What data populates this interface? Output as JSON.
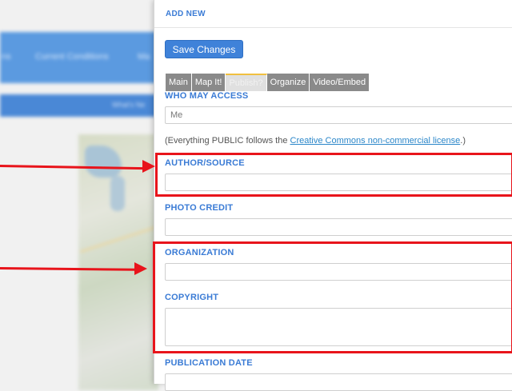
{
  "background": {
    "nav_items": [
      "ns",
      "Current Conditions",
      "Ma"
    ],
    "subbar_text": "What's Ne"
  },
  "panel": {
    "header": "ADD NEW",
    "save_label": "Save Changes",
    "tabs": [
      {
        "label": "Main",
        "active": false
      },
      {
        "label": "Map It!",
        "active": false
      },
      {
        "label": "Publish?",
        "active": true
      },
      {
        "label": "Organize",
        "active": false
      },
      {
        "label": "Video/Embed",
        "active": false
      }
    ],
    "who_label": "WHO MAY ACCESS",
    "who_value": "Me",
    "note_prefix": "(Everything PUBLIC follows the ",
    "note_link": "Creative Commons non-commercial license",
    "note_suffix": ".)",
    "author_label": "AUTHOR/SOURCE",
    "photo_label": "PHOTO CREDIT",
    "org_label": "ORGANIZATION",
    "copyright_label": "COPYRIGHT",
    "pubdate_label": "PUBLICATION DATE"
  },
  "colors": {
    "accent": "#3a7bd5",
    "button": "#3f82d9",
    "callout": "#e8141b",
    "tab_inactive": "#8a8a8a",
    "link": "#2a86c9"
  }
}
